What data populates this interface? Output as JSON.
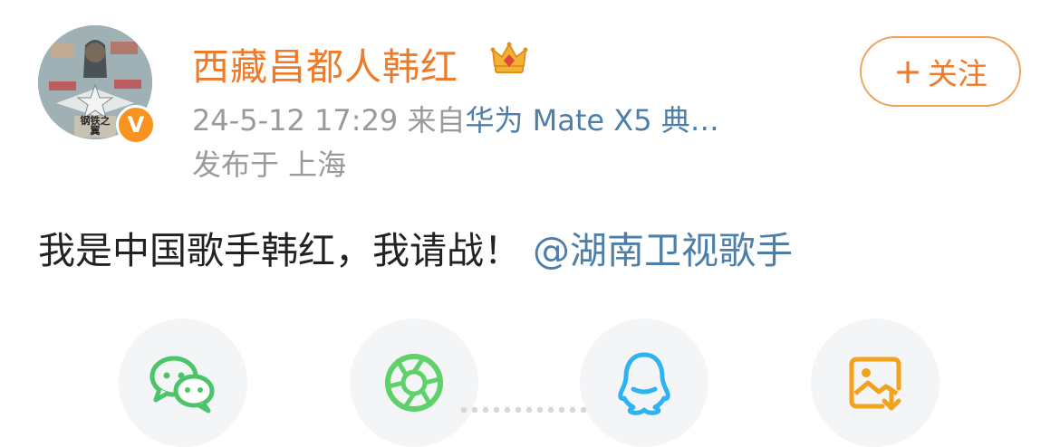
{
  "user": {
    "name": "西藏昌都人韩红",
    "avatar_text": "钢铁之翼",
    "verified_badge": "V",
    "crown_color": "#f2b233"
  },
  "meta": {
    "time": "24-5-12 17:29",
    "from_label": "来自",
    "device": "华为 Mate X5 典…",
    "location": "发布于 上海"
  },
  "follow_button": {
    "icon": "+",
    "label": "关注"
  },
  "post": {
    "text": "我是中国歌手韩红，我请战！",
    "mention": "@湖南卫视歌手"
  },
  "share": [
    {
      "icon": "wechat-icon",
      "color": "#4cc46a"
    },
    {
      "icon": "moments-icon",
      "color": "#5fd16b"
    },
    {
      "icon": "qq-icon",
      "color": "#2fb2f0"
    },
    {
      "icon": "save-image-icon",
      "color": "#f2a21d"
    }
  ],
  "colors": {
    "orange": "#ef7a2a",
    "link": "#4d7fa8",
    "gray": "#9a9a9a"
  }
}
